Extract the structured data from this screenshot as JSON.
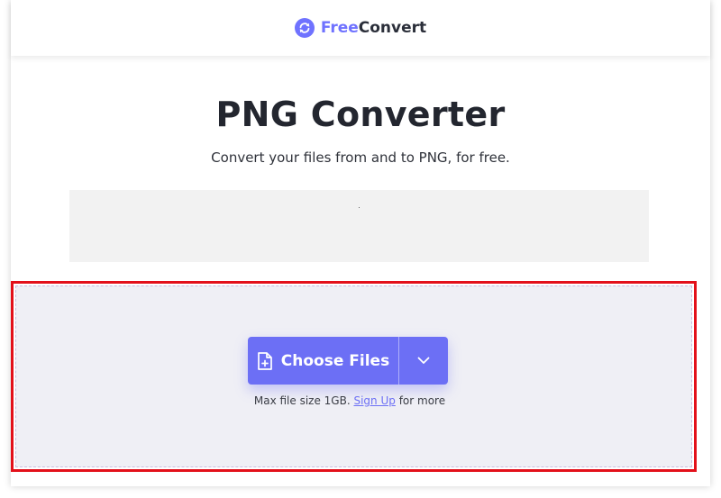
{
  "header": {
    "logo_free": "Free",
    "logo_convert": "Convert",
    "logo_icon": "refresh-circle-icon"
  },
  "main": {
    "title": "PNG Converter",
    "subtitle": "Convert your files from and to PNG, for free."
  },
  "upload": {
    "choose_label": "Choose Files",
    "choose_icon": "file-plus-icon",
    "dropdown_icon": "chevron-down-icon",
    "max_prefix": "Max file size 1GB.",
    "signup_link": "Sign Up",
    "max_suffix": "for more"
  },
  "colors": {
    "accent": "#6c6ff5",
    "highlight_border": "#e3101a",
    "dropzone_bg": "#efeff5"
  }
}
